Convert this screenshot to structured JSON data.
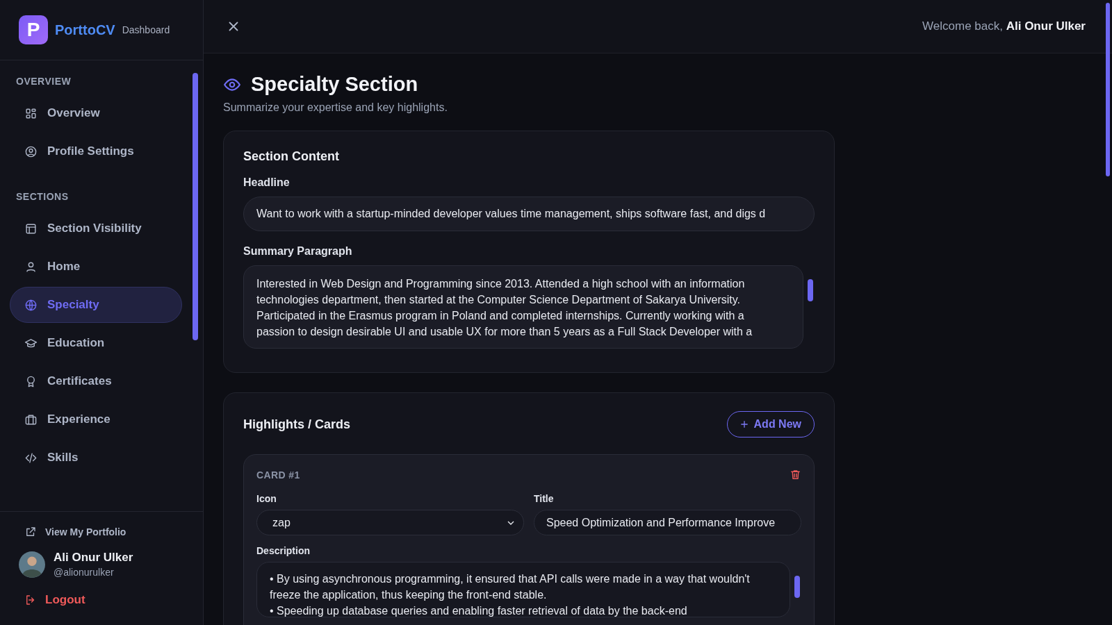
{
  "brand": {
    "logo_letter": "P",
    "name": "PorttoCV",
    "subtitle": "Dashboard"
  },
  "sidebar": {
    "groups": [
      {
        "heading": "OVERVIEW",
        "items": [
          {
            "label": "Overview",
            "kind": "grid",
            "selected": false
          },
          {
            "label": "Profile Settings",
            "kind": "user-circle",
            "selected": false
          }
        ]
      },
      {
        "heading": "SECTIONS",
        "items": [
          {
            "label": "Section Visibility",
            "kind": "layout",
            "selected": false
          },
          {
            "label": "Home",
            "kind": "user",
            "selected": false
          },
          {
            "label": "Specialty",
            "kind": "globe",
            "selected": true
          },
          {
            "label": "Education",
            "kind": "cap",
            "selected": false
          },
          {
            "label": "Certificates",
            "kind": "award",
            "selected": false
          },
          {
            "label": "Experience",
            "kind": "briefcase",
            "selected": false
          },
          {
            "label": "Skills",
            "kind": "code",
            "selected": false
          }
        ]
      }
    ],
    "portfolio_link": "View My Portfolio",
    "user": {
      "name": "Ali Onur Ulker",
      "handle": "@alionurulker"
    },
    "logout": "Logout"
  },
  "header": {
    "welcome": "Welcome back, **Ali Onur Ulker**"
  },
  "page": {
    "title": "Specialty Section",
    "subtitle": "Summarize your expertise and key highlights."
  },
  "section_content": {
    "title": "Section Content",
    "headline_label": "Headline",
    "headline_value": "Want to work with a startup-minded developer values time management, ships software fast, and digs d",
    "summary_label": "Summary Paragraph",
    "summary_value": "Interested in Web Design and Programming since 2013. Attended a high school with an information technologies department, then started at the Computer Science Department of Sakarya University. Participated in the Erasmus program in Poland and completed internships. Currently working with a passion to design desirable UI and usable UX for more than 5 years as a Full Stack Developer with a"
  },
  "highlights": {
    "title": "Highlights / Cards",
    "add_button": "Add New",
    "cards": [
      {
        "label": "CARD #1",
        "icon_label": "Icon",
        "icon_value": "zap",
        "title_label": "Title",
        "title_value": "Speed Optimization and Performance Improve",
        "description_label": "Description",
        "description_lines": [
          "• By using asynchronous programming, it ensured that API calls were made in a way that wouldn't freeze the application, thus keeping the front-end stable.",
          "• Speeding up database queries and enabling faster retrieval of data by the back-end"
        ]
      }
    ]
  }
}
